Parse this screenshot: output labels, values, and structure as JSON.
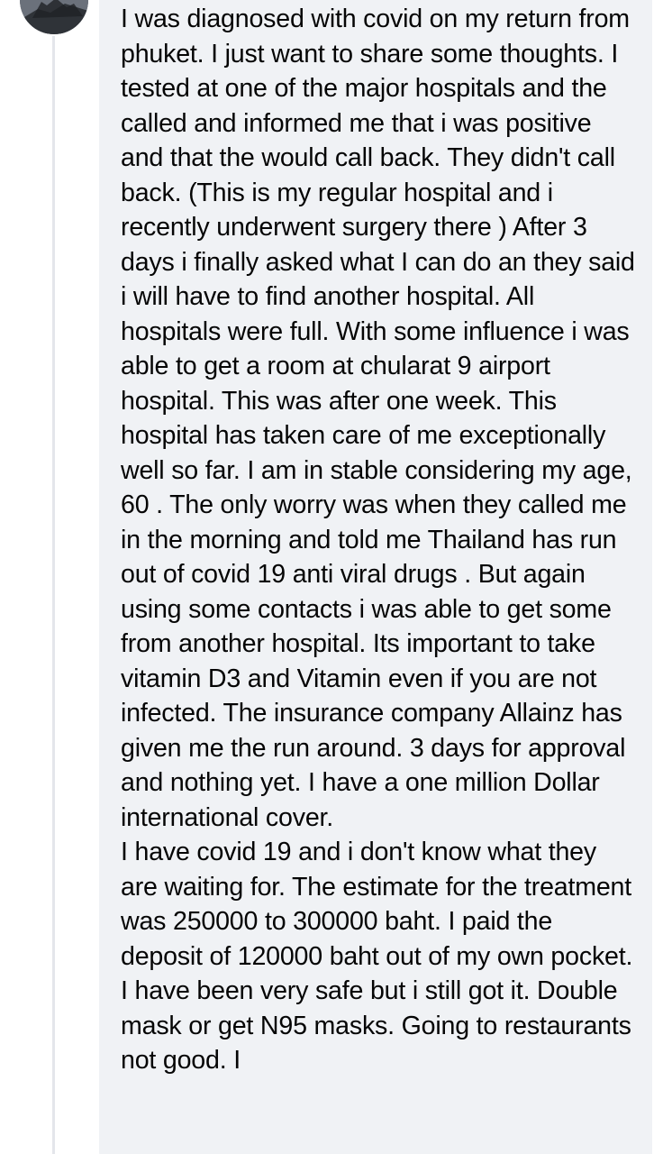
{
  "comment": {
    "paragraphs": [
      "I was diagnosed with covid on my return from phuket. I just want to share some thoughts. I tested at one of the major hospitals and the called and informed me that i was positive and that the would call back. They didn't call back. (This is my regular hospital and i recently underwent surgery there  ) After 3 days i finally asked what I can do an they said i will have to find another hospital. All hospitals were full. With some influence i was able to get a room at chularat 9 airport hospital. This was after one week. This hospital has taken care of me exceptionally well so far. I am in stable considering my age, 60 . The only worry was when they called me in the morning and told me Thailand has run out of covid 19 anti viral drugs . But again using some contacts i was able to get some from another hospital. Its important to  take vitamin D3 and Vitamin even if you are not infected. The insurance company Allainz has given me the run around. 3 days for approval and nothing yet. I have a one million Dollar international cover.",
      "I have covid 19 and  i don't know what they are waiting for. The estimate for the treatment was 250000 to 300000 baht. I paid the deposit of 120000 baht out of my own pocket. I have been very safe but i still got it. Double mask or get N95 masks. Going to restaurants not good. I"
    ]
  },
  "avatar": {
    "icon": "profile-photo"
  },
  "colors": {
    "bubble_background": "#f0f2f5",
    "text": "#050505",
    "thread_line": "#e4e6eb"
  }
}
